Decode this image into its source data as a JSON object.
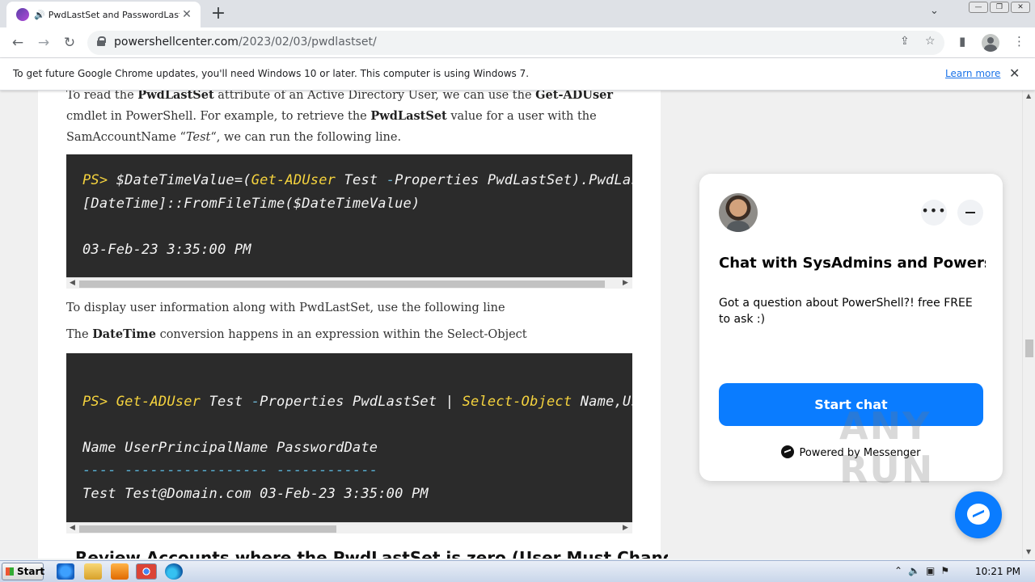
{
  "tab": {
    "title": "PwdLastSet and PasswordLastSe",
    "speaker_glyph": "🔊",
    "close_glyph": "✕",
    "new_tab_glyph": "+",
    "tab_search_glyph": "⌄"
  },
  "window_controls": [
    "—",
    "❐",
    "✕"
  ],
  "toolbar": {
    "back_glyph": "←",
    "forward_glyph": "→",
    "reload_glyph": "↻",
    "url_host": "powershellcenter.com",
    "url_path": "/2023/02/03/pwdlastset/",
    "share_glyph": "⇪",
    "bookmark_glyph": "☆",
    "sidepanel_glyph": "▮",
    "menu_glyph": "⋮"
  },
  "infobar": {
    "message": "To get future Google Chrome updates, you'll need Windows 10 or later. This computer is using Windows 7.",
    "learn_more": "Learn more",
    "close_glyph": "✕"
  },
  "article": {
    "p1": {
      "t1": "To read the ",
      "b1": "PwdLastSet",
      "t2": " attribute of an Active Directory User, we can use the ",
      "b2": "Get-ADUser",
      "t3": " cmdlet in PowerShell. For example, to retrieve the ",
      "b3": "PwdLastSet",
      "t4": " value for a user with the SamAccountName “",
      "i1": "Test",
      "t5": "“, we can run the following line."
    },
    "code1": {
      "prompt": "PS>",
      "var": " $DateTimeValue=(",
      "cmd": "Get-ADUser",
      "arg1": " Test ",
      "dash": "-",
      "rest": "Properties PwdLastSet).PwdLastSet",
      "line2": "[DateTime]::FromFileTime($DateTimeValue)",
      "output": "03-Feb-23 3:35:00 PM"
    },
    "p2": "To display user information along with PwdLastSet, use the following line",
    "p3": {
      "t1": "The ",
      "b1": "DateTime",
      "t2": " conversion happens in an expression within the Select-Object"
    },
    "code2": {
      "prompt": "PS>",
      "cmd": "Get-ADUser",
      "arg1": " Test ",
      "dash": "-",
      "props": "Properties PwdLastSet ",
      "pipe": "|",
      "cmd2": "Select-Object",
      "rest": " Name,UserPrincipalName",
      "header": "Name UserPrincipalName PasswordDate",
      "sep": "---- ----------------- ------------",
      "row": "Test Test@Domain.com 03-Feb-23 3:35:00 PM"
    },
    "heading": "Review Accounts where the PwdLastSet is zero (User Must Change"
  },
  "chat": {
    "title": "Chat with SysAdmins and Powers...",
    "description": "Got a question about PowerShell?! free FREE to ask :)",
    "start_button": "Start chat",
    "powered_by": "Powered by Messenger",
    "more_glyph": "•••"
  },
  "watermark": "ANY RUN",
  "taskbar": {
    "start_label": "Start",
    "tray_glyphs": [
      "⌃",
      "🔈",
      "▣",
      "⚑"
    ],
    "clock": "10:21 PM"
  },
  "colors": {
    "code_bg": "#2b2b2b",
    "code_keyword": "#f5d33e",
    "messenger_blue": "#0a7cff",
    "link_blue": "#1a73e8"
  }
}
